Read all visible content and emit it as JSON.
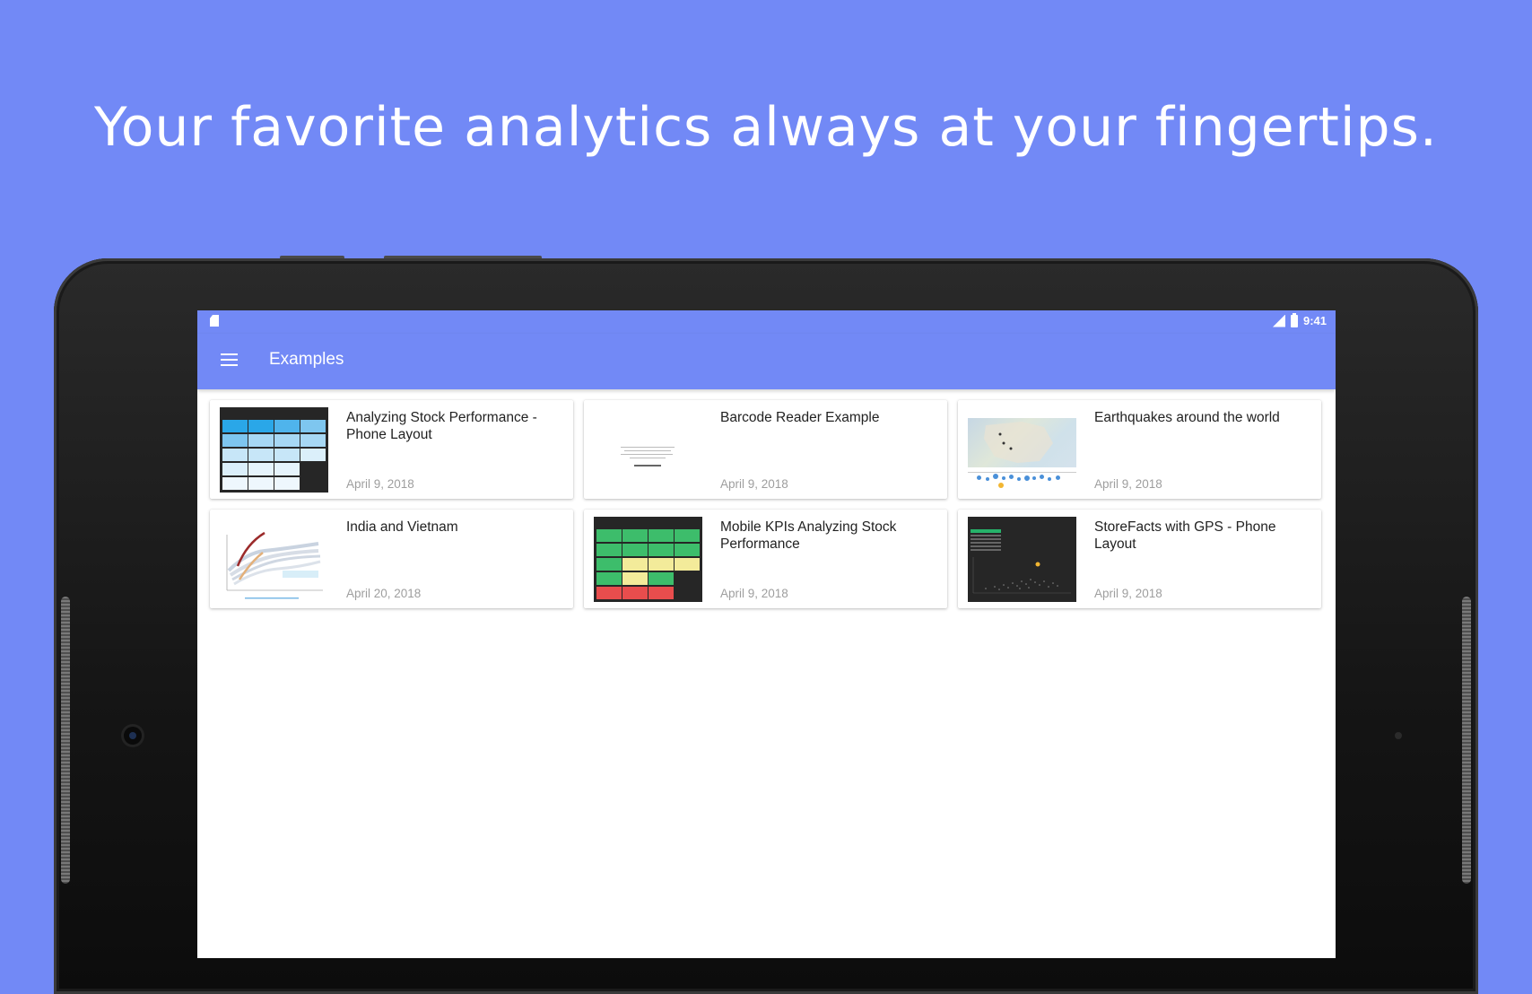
{
  "headline": "Your favorite analytics always at your fingertips.",
  "status_bar": {
    "time": "9:41",
    "sd_icon": "sd-card-icon",
    "signal_icon": "lte-signal-icon",
    "battery_icon": "battery-icon"
  },
  "app_bar": {
    "title": "Examples",
    "menu_icon": "hamburger-menu-icon"
  },
  "colors": {
    "brand": "#7289f6",
    "date_text": "#9e9e9e",
    "title_text": "#222222"
  },
  "cards": [
    {
      "title": "Analyzing Stock Performance - Phone Layout",
      "date": "April 9, 2018",
      "thumbnail": "stock-kpi-tiles"
    },
    {
      "title": "Barcode Reader Example",
      "date": "April 9, 2018",
      "thumbnail": "text-document"
    },
    {
      "title": "Earthquakes around the world",
      "date": "April 9, 2018",
      "thumbnail": "map-scatter"
    },
    {
      "title": "India and Vietnam",
      "date": "April 20, 2018",
      "thumbnail": "line-chart"
    },
    {
      "title": "Mobile KPIs Analyzing Stock Performance",
      "date": "April 9, 2018",
      "thumbnail": "color-kpi-tiles"
    },
    {
      "title": "StoreFacts with GPS - Phone Layout",
      "date": "April 9, 2018",
      "thumbnail": "dark-scatter"
    }
  ]
}
